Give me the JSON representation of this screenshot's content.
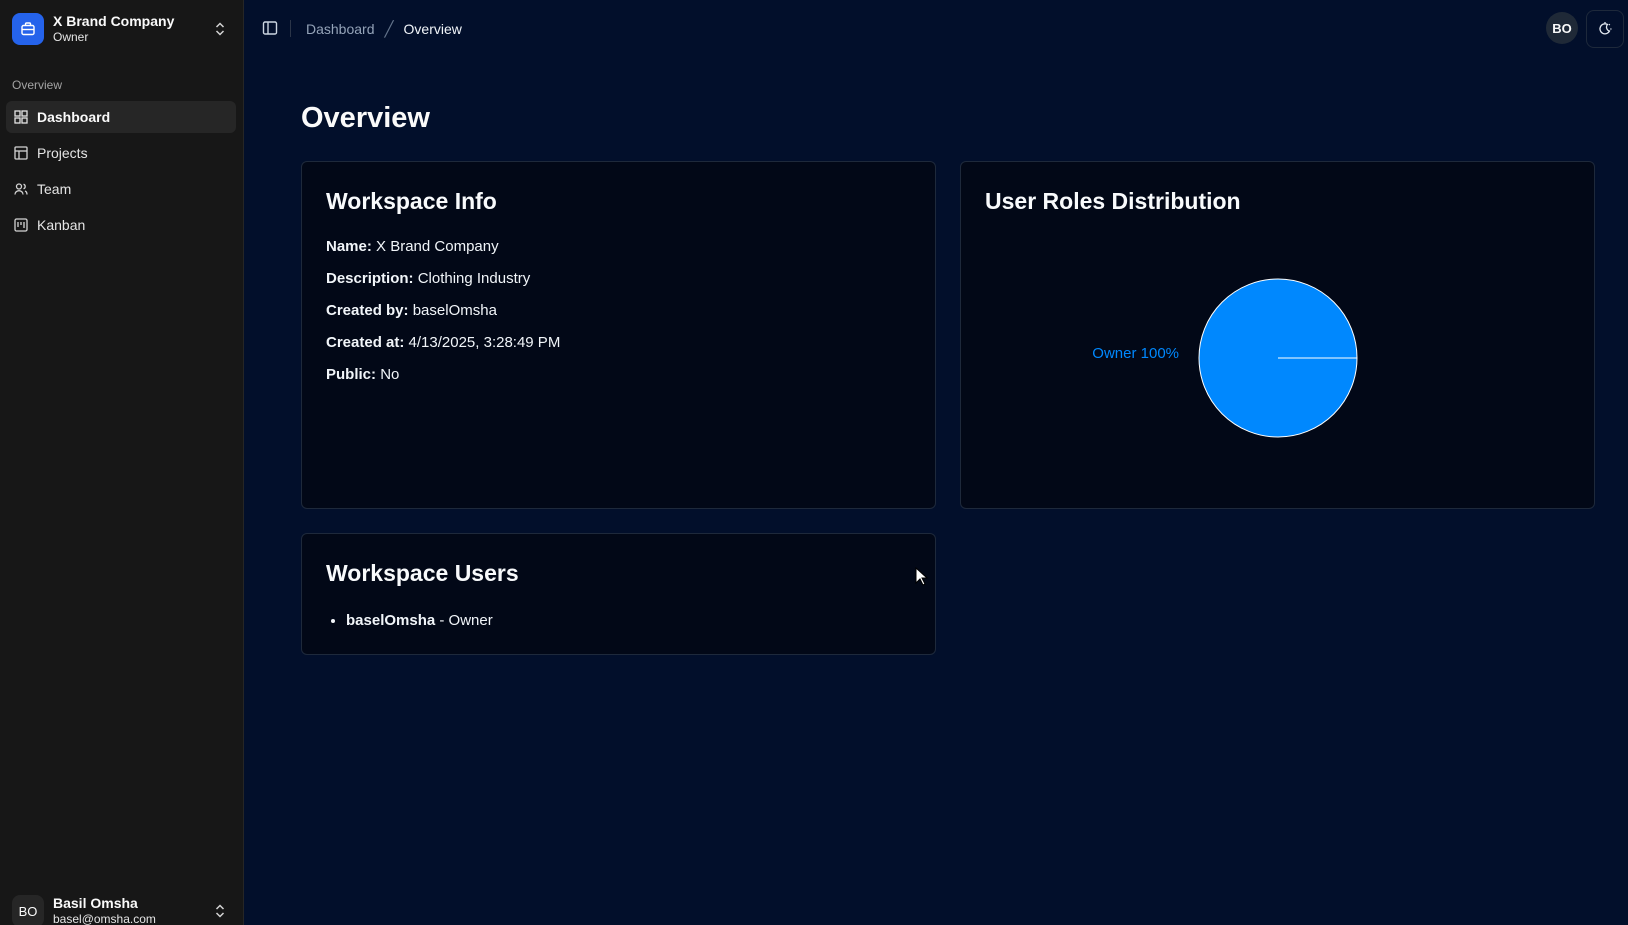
{
  "sidebar": {
    "workspace": {
      "name": "X Brand Company",
      "role": "Owner"
    },
    "group_label": "Overview",
    "items": [
      {
        "label": "Dashboard",
        "icon": "layout-grid-icon",
        "active": true
      },
      {
        "label": "Projects",
        "icon": "table-icon",
        "active": false
      },
      {
        "label": "Team",
        "icon": "users-icon",
        "active": false
      },
      {
        "label": "Kanban",
        "icon": "kanban-icon",
        "active": false
      }
    ],
    "user": {
      "initials": "BO",
      "name": "Basil Omsha",
      "email": "basel@omsha.com"
    }
  },
  "header": {
    "breadcrumb": {
      "parent": "Dashboard",
      "current": "Overview"
    },
    "avatar_initials": "BO"
  },
  "main": {
    "title": "Overview",
    "workspace_info": {
      "title": "Workspace Info",
      "fields": [
        {
          "label": "Name:",
          "value": "X Brand Company"
        },
        {
          "label": "Description:",
          "value": "Clothing Industry"
        },
        {
          "label": "Created by:",
          "value": "baselOmsha"
        },
        {
          "label": "Created at:",
          "value": "4/13/2025, 3:28:49 PM"
        },
        {
          "label": "Public:",
          "value": "No"
        }
      ]
    },
    "roles": {
      "title": "User Roles Distribution"
    },
    "users": {
      "title": "Workspace Users",
      "list": [
        {
          "name": "baselOmsha",
          "role": "- Owner"
        }
      ]
    }
  },
  "colors": {
    "background": "#020f2b",
    "sidebar": "#171717",
    "accent": "#2563eb",
    "pie": "#0088fe"
  },
  "chart_data": {
    "type": "pie",
    "series": [
      {
        "values": [
          100
        ]
      }
    ],
    "categories": [
      "Owner"
    ],
    "data_labels": [
      "Owner 100%"
    ]
  }
}
